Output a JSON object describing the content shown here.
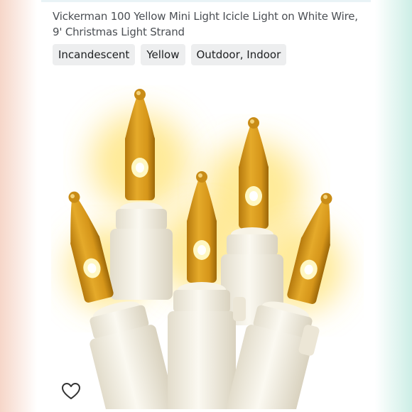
{
  "product": {
    "title_line1": "Vickerman 100 Yellow Mini Light Icicle Light on White Wire,",
    "title_line2": "9' Christmas Light Strand"
  },
  "chips": [
    {
      "label": "Incandescent"
    },
    {
      "label": "Yellow"
    },
    {
      "label": "Outdoor, Indoor"
    }
  ],
  "icons": {
    "share": "share-icon",
    "favorite": "heart-outline-icon"
  },
  "colors": {
    "bulb_amber": "#e0a21a",
    "bulb_glow": "#fff3a0",
    "socket_white": "#f4f1e6",
    "chip_bg": "#edeeef",
    "text": "#4b4f54"
  }
}
